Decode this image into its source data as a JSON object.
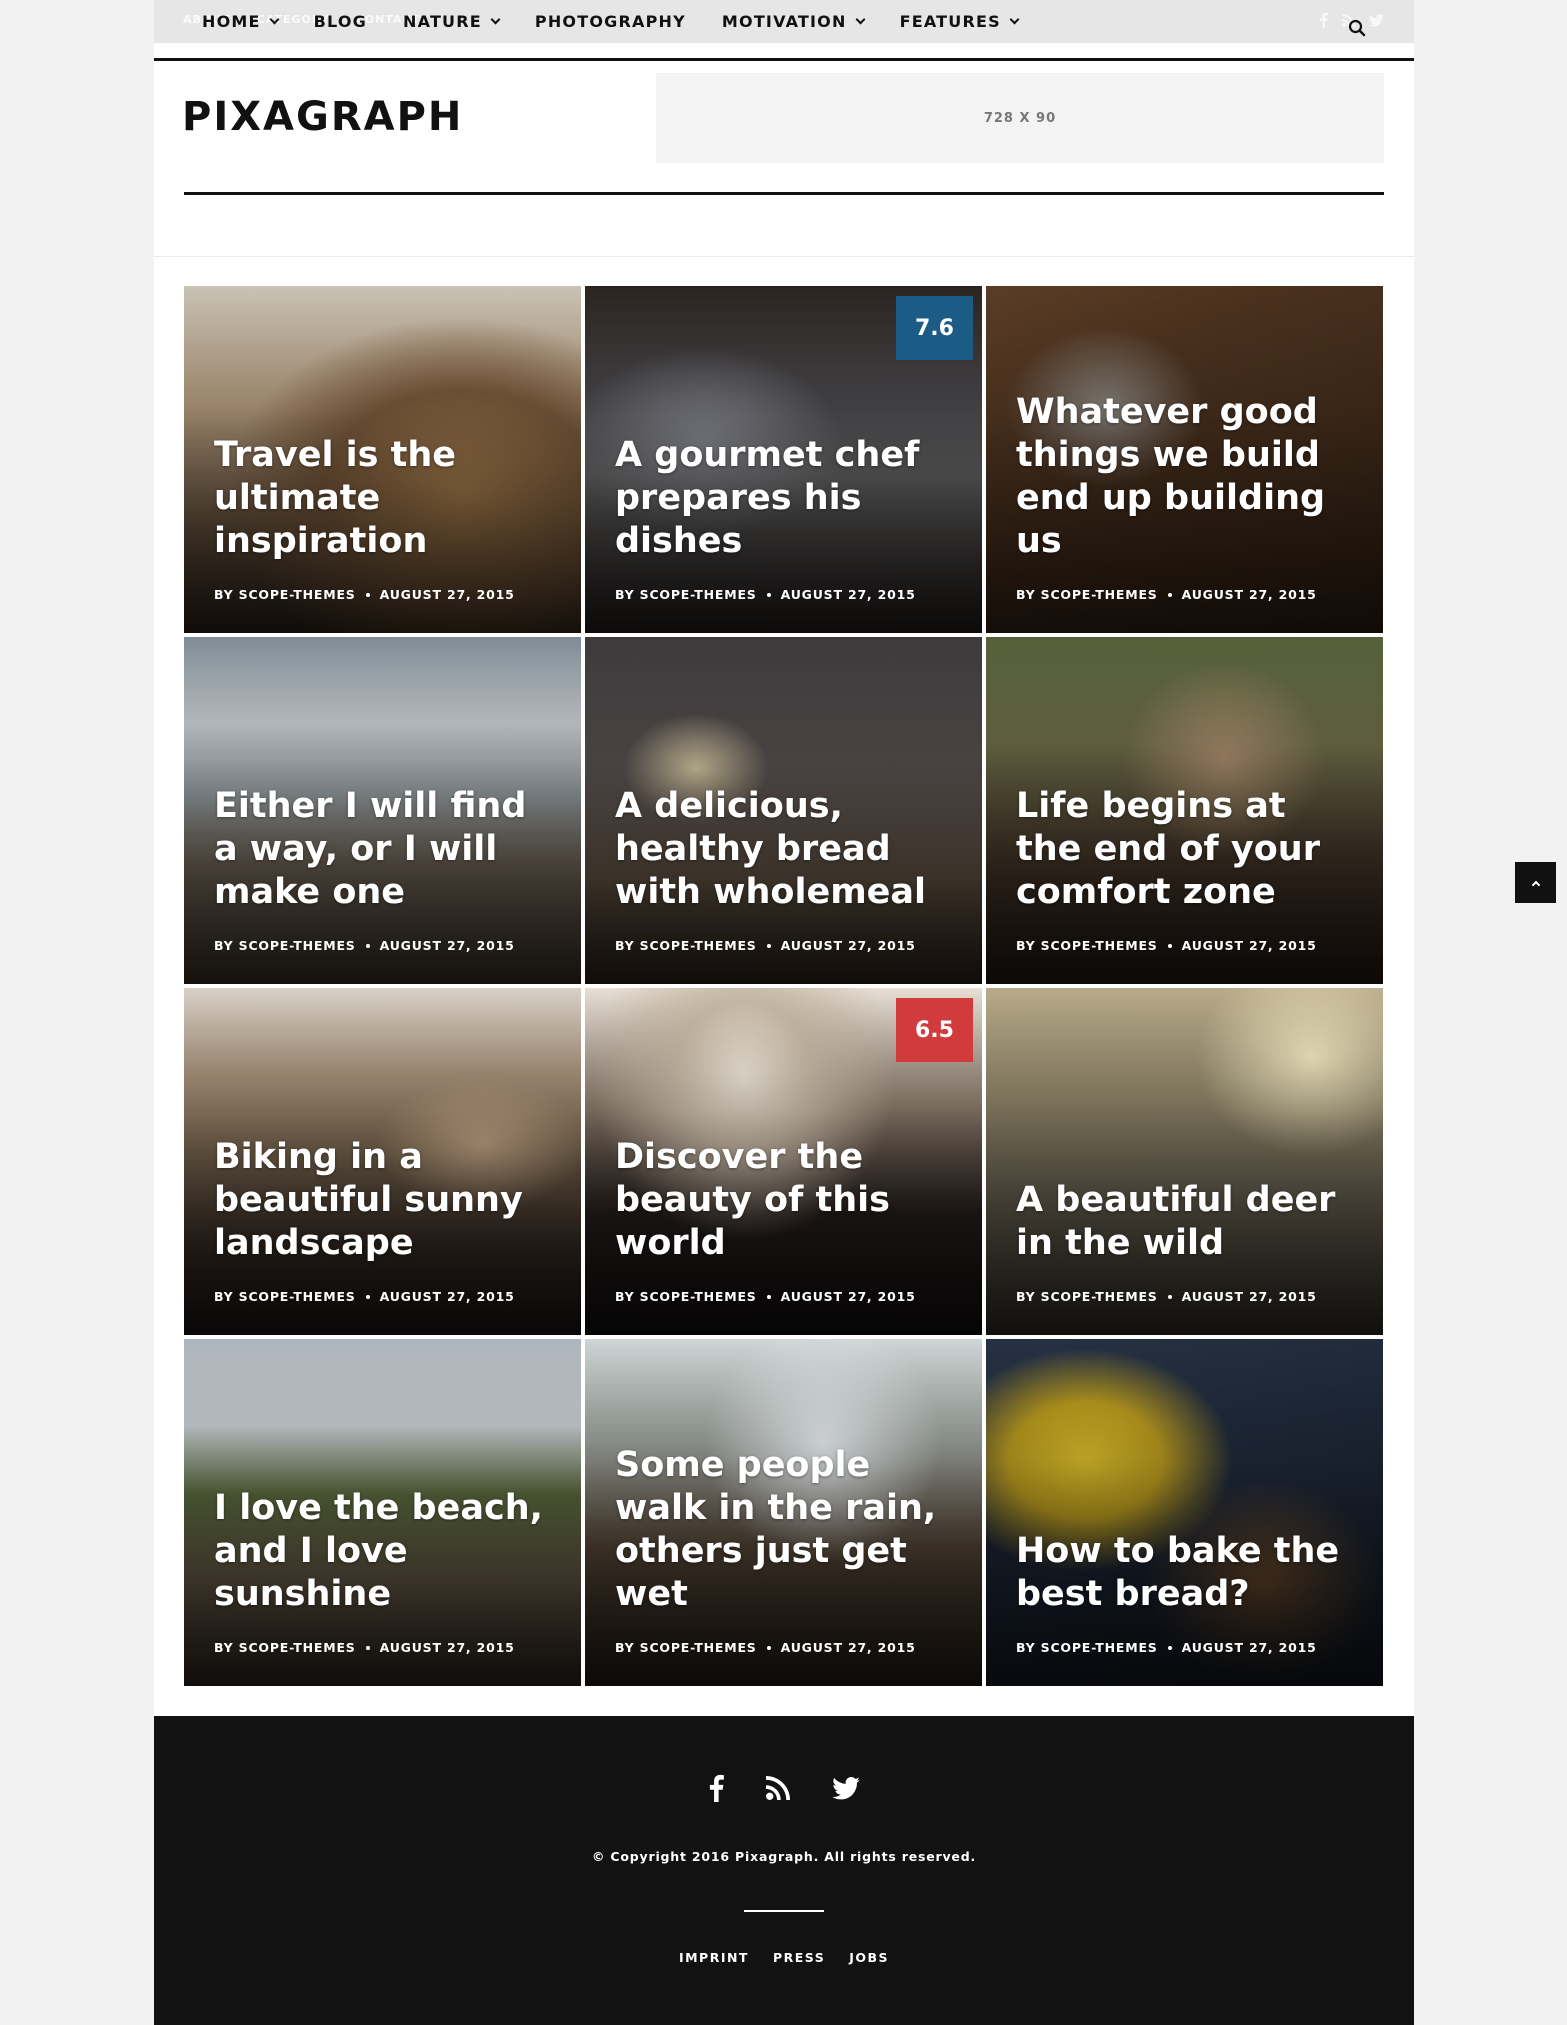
{
  "utility": {
    "items": [
      "ABOUT",
      "CATEGORY",
      "CONTACT"
    ]
  },
  "nav": {
    "items": [
      {
        "label": "HOME",
        "dropdown": true
      },
      {
        "label": "BLOG",
        "dropdown": false
      },
      {
        "label": "NATURE",
        "dropdown": true
      },
      {
        "label": "PHOTOGRAPHY",
        "dropdown": false
      },
      {
        "label": "MOTIVATION",
        "dropdown": true
      },
      {
        "label": "FEATURES",
        "dropdown": true
      }
    ],
    "social_icons": [
      "facebook-icon",
      "rss-icon",
      "twitter-icon"
    ],
    "search_icon": "search-icon"
  },
  "header": {
    "logo": "PIXAGRAPH",
    "ad_label": "728 X 90"
  },
  "posts": [
    {
      "title": "Travel is the ultimate inspiration",
      "author": "BY SCOPE-THEMES",
      "date": "AUGUST 27, 2015"
    },
    {
      "title": "A gourmet chef prepares his dishes",
      "author": "BY SCOPE-THEMES",
      "date": "AUGUST 27, 2015",
      "score": "7.6",
      "score_color": "#1b5b86"
    },
    {
      "title": "Whatever good things we build end up building us",
      "author": "BY SCOPE-THEMES",
      "date": "AUGUST 27, 2015"
    },
    {
      "title": "Either I will find a way, or I will make one",
      "author": "BY SCOPE-THEMES",
      "date": "AUGUST 27, 2015"
    },
    {
      "title": "A delicious, healthy bread with wholemeal",
      "author": "BY SCOPE-THEMES",
      "date": "AUGUST 27, 2015"
    },
    {
      "title": "Life begins at the end of your comfort zone",
      "author": "BY SCOPE-THEMES",
      "date": "AUGUST 27, 2015"
    },
    {
      "title": "Biking in a beautiful sunny landscape",
      "author": "BY SCOPE-THEMES",
      "date": "AUGUST 27, 2015"
    },
    {
      "title": "Discover the beauty of this world",
      "author": "BY SCOPE-THEMES",
      "date": "AUGUST 27, 2015",
      "score": "6.5",
      "score_color": "#d23b3b"
    },
    {
      "title": "A beautiful deer in the wild",
      "author": "BY SCOPE-THEMES",
      "date": "AUGUST 27, 2015"
    },
    {
      "title": "I love the beach, and I love sunshine",
      "author": "BY SCOPE-THEMES",
      "date": "AUGUST 27, 2015"
    },
    {
      "title": "Some people walk in the rain, others just get wet",
      "author": "BY SCOPE-THEMES",
      "date": "AUGUST 27, 2015"
    },
    {
      "title": "How to bake the best bread?",
      "author": "BY SCOPE-THEMES",
      "date": "AUGUST 27, 2015"
    }
  ],
  "footer": {
    "social_icons": [
      "facebook-icon",
      "rss-icon",
      "twitter-icon"
    ],
    "copyright": "© Copyright 2016 Pixagraph. All rights reserved.",
    "links": [
      "IMPRINT",
      "PRESS",
      "JOBS"
    ]
  },
  "back_to_top_icon": "chevron-up-icon"
}
